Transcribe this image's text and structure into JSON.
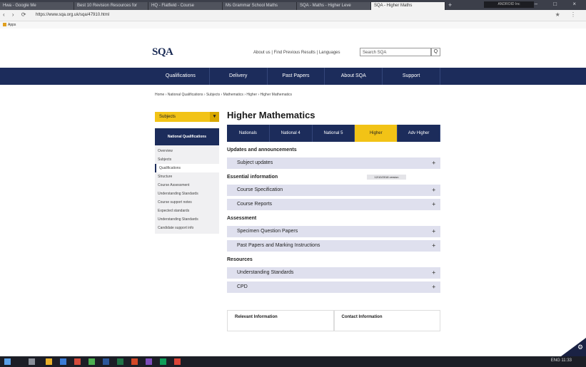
{
  "browser": {
    "tabs": [
      {
        "label": "Hwa - Google Me",
        "active": false
      },
      {
        "label": "Best 10 Revision Resources for",
        "active": false
      },
      {
        "label": "HQ - Flatfield - Course",
        "active": false
      },
      {
        "label": "Ms Grammar School Maths",
        "active": false
      },
      {
        "label": "SQA - Maths - Higher Leve",
        "active": false
      },
      {
        "label": "SQA - Higher Maths",
        "active": true
      }
    ],
    "new_tab": "+",
    "profile": "ANDROID Inc",
    "window_controls": "– □ ×",
    "nav_buttons": "‹ › ⟳",
    "url": "https://www.sqa.org.uk/sqa/47910.html",
    "bookmarks_label": "Apps"
  },
  "site": {
    "logo": "SQA",
    "top_links": "About us  |  Find Previous Results  |  Languages",
    "search_placeholder": "Search SQA",
    "search_button": "Q",
    "nav": [
      "Qualifications",
      "Delivery",
      "Past Papers",
      "About SQA",
      "Support"
    ],
    "breadcrumb": "Home › National Qualifications › Subjects › Mathematics › Higher › Higher Mathematics"
  },
  "sidebar": {
    "subject_select": "Subjects",
    "subject_select_btn": "▾",
    "heading": "National Qualifications",
    "items": [
      "Overview",
      "Subjects",
      "Qualifications",
      "Structure",
      "Course Assessment",
      "Understanding Standards",
      "Course support notes",
      "Expected standards",
      "Understanding Standards",
      "Candidate support info"
    ],
    "selected_index": 2
  },
  "main": {
    "title": "Higher Mathematics",
    "tabs": [
      "Nationals",
      "National 4",
      "National 5",
      "Higher",
      "Adv Higher"
    ],
    "active_tab_index": 3,
    "section_updates": "Updates and announcements",
    "acc_subject_updates": "Subject updates",
    "section_course_info": "Essential information",
    "stamp": "12/10/2018 version",
    "acc_course_spec": "Course Specification",
    "acc_course_reports": "Course Reports",
    "section_assessment": "Assessment",
    "acc_specimen": "Specimen Question Papers",
    "acc_past_papers": "Past Papers and Marking Instructions",
    "section_resources": "Resources",
    "acc_understanding": "Understanding Standards",
    "acc_cpd": "CPD",
    "expand_icon": "+",
    "box_left": "Relevant Information",
    "box_right": "Contact Information"
  },
  "taskbar": {
    "tray": "ENG  11:33"
  }
}
